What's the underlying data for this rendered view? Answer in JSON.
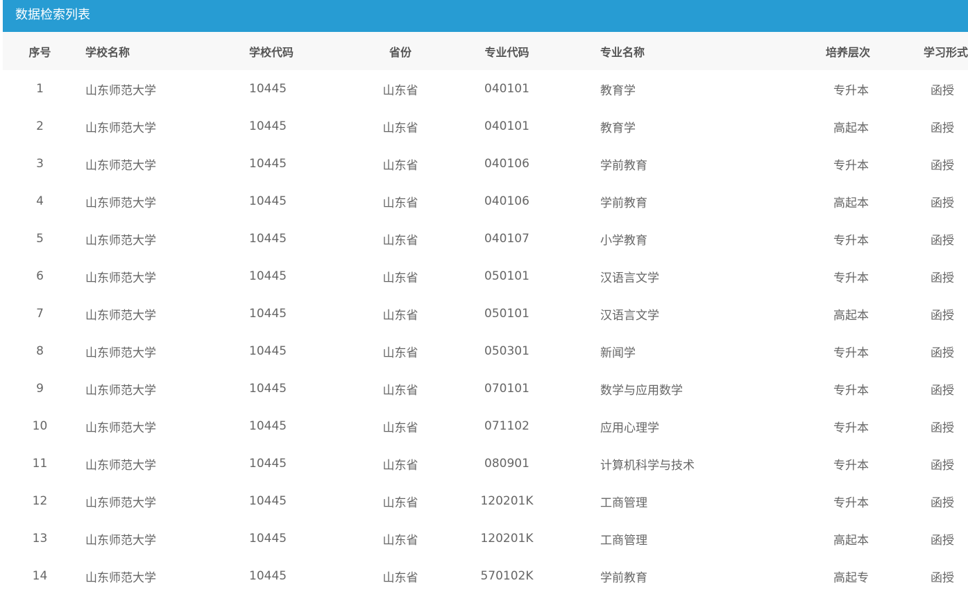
{
  "panel": {
    "title": "数据检索列表"
  },
  "table": {
    "columns": [
      "序号",
      "学校名称",
      "学校代码",
      "省份",
      "专业代码",
      "专业名称",
      "培养层次",
      "学习形式"
    ],
    "rows": [
      [
        "1",
        "山东师范大学",
        "10445",
        "山东省",
        "040101",
        "教育学",
        "专升本",
        "函授"
      ],
      [
        "2",
        "山东师范大学",
        "10445",
        "山东省",
        "040101",
        "教育学",
        "高起本",
        "函授"
      ],
      [
        "3",
        "山东师范大学",
        "10445",
        "山东省",
        "040106",
        "学前教育",
        "专升本",
        "函授"
      ],
      [
        "4",
        "山东师范大学",
        "10445",
        "山东省",
        "040106",
        "学前教育",
        "高起本",
        "函授"
      ],
      [
        "5",
        "山东师范大学",
        "10445",
        "山东省",
        "040107",
        "小学教育",
        "专升本",
        "函授"
      ],
      [
        "6",
        "山东师范大学",
        "10445",
        "山东省",
        "050101",
        "汉语言文学",
        "专升本",
        "函授"
      ],
      [
        "7",
        "山东师范大学",
        "10445",
        "山东省",
        "050101",
        "汉语言文学",
        "高起本",
        "函授"
      ],
      [
        "8",
        "山东师范大学",
        "10445",
        "山东省",
        "050301",
        "新闻学",
        "专升本",
        "函授"
      ],
      [
        "9",
        "山东师范大学",
        "10445",
        "山东省",
        "070101",
        "数学与应用数学",
        "专升本",
        "函授"
      ],
      [
        "10",
        "山东师范大学",
        "10445",
        "山东省",
        "071102",
        "应用心理学",
        "专升本",
        "函授"
      ],
      [
        "11",
        "山东师范大学",
        "10445",
        "山东省",
        "080901",
        "计算机科学与技术",
        "专升本",
        "函授"
      ],
      [
        "12",
        "山东师范大学",
        "10445",
        "山东省",
        "120201K",
        "工商管理",
        "专升本",
        "函授"
      ],
      [
        "13",
        "山东师范大学",
        "10445",
        "山东省",
        "120201K",
        "工商管理",
        "高起本",
        "函授"
      ],
      [
        "14",
        "山东师范大学",
        "10445",
        "山东省",
        "570102K",
        "学前教育",
        "高起专",
        "函授"
      ]
    ]
  },
  "colors": {
    "header_bar": "#279cd3",
    "table_head_bg": "#f8f8f8",
    "text": "#666666"
  }
}
